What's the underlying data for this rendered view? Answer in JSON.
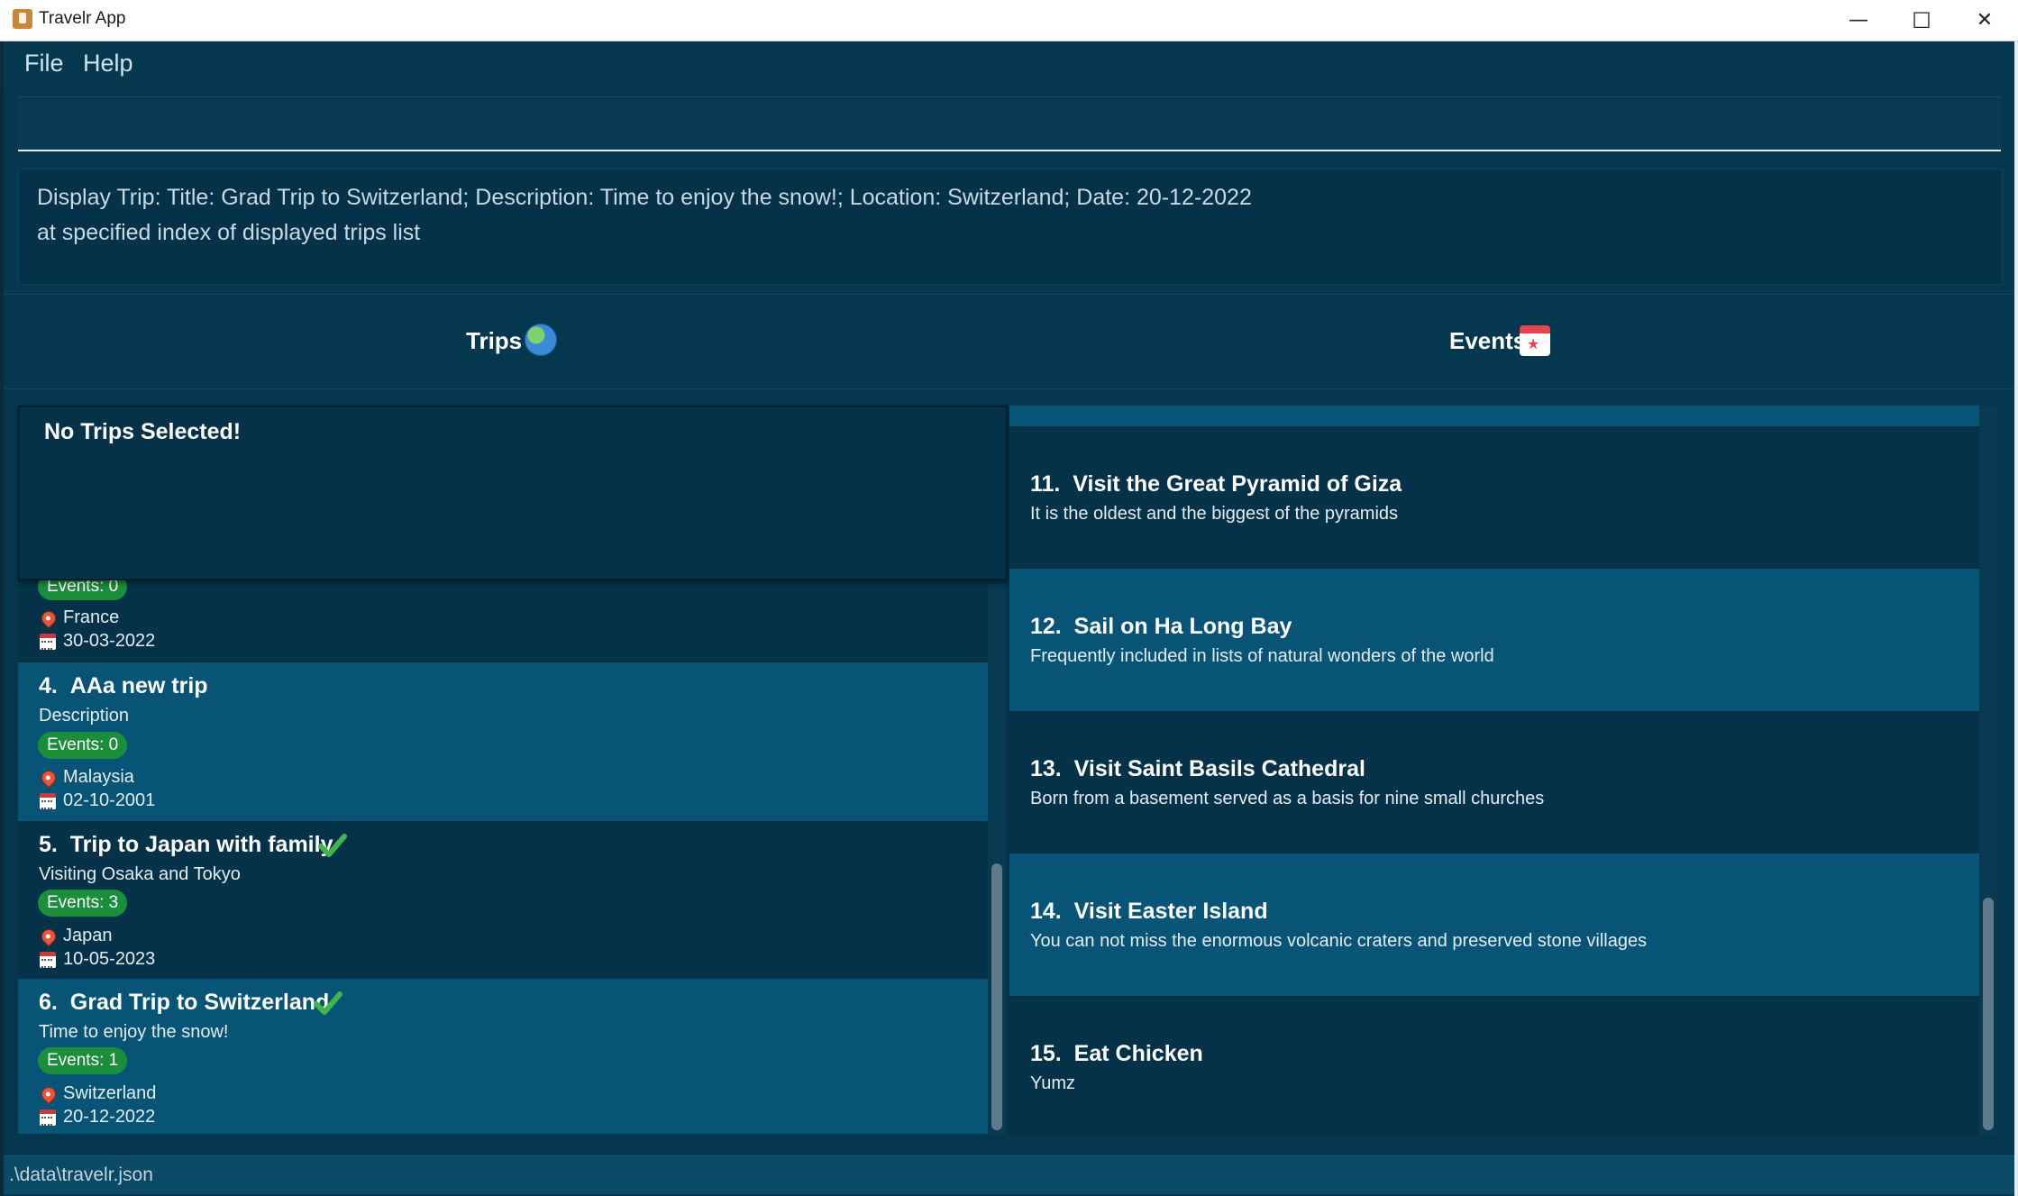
{
  "window": {
    "title": "Travelr App",
    "minimize_glyph": "—",
    "maximize_glyph": "☐",
    "close_glyph": "✕"
  },
  "menu": {
    "file": "File",
    "help": "Help"
  },
  "command_box": {
    "value": ""
  },
  "result_display": {
    "lines": [
      "Display Trip: Title: Grad Trip to Switzerland; Description: Time to enjoy the snow!; Location: Switzerland; Date: 20-12-2022",
      "at specified index of displayed trips list"
    ]
  },
  "tabs": {
    "trips": "Trips",
    "events": "Events"
  },
  "selected_trip": {
    "message": "No Trips Selected!"
  },
  "trips": [
    {
      "index": "",
      "title": "",
      "description": "",
      "events": "Events: 0",
      "location": "France",
      "date": "30-03-2022",
      "completed": false
    },
    {
      "index": "4.",
      "title": "AAa new trip",
      "description": "Description",
      "events": "Events: 0",
      "location": "Malaysia",
      "date": "02-10-2001",
      "completed": false
    },
    {
      "index": "5.",
      "title": "Trip to Japan with family",
      "description": "Visiting Osaka and Tokyo",
      "events": "Events: 3",
      "location": "Japan",
      "date": "10-05-2023",
      "completed": true
    },
    {
      "index": "6.",
      "title": "Grad Trip to Switzerland",
      "description": "Time to enjoy the snow!",
      "events": "Events: 1",
      "location": "Switzerland",
      "date": "20-12-2022",
      "completed": true
    }
  ],
  "events": [
    {
      "index": "11.",
      "title": "Visit the Great Pyramid of Giza",
      "description": "It is the oldest and the biggest of the pyramids"
    },
    {
      "index": "12.",
      "title": "Sail on Ha Long Bay",
      "description": "Frequently included in lists of natural wonders of the world"
    },
    {
      "index": "13.",
      "title": "Visit Saint Basils Cathedral",
      "description": "Born from a basement served as a basis for nine small churches"
    },
    {
      "index": "14.",
      "title": "Visit Easter Island",
      "description": "You can not miss the enormous volcanic craters and preserved stone villages"
    },
    {
      "index": "15.",
      "title": "Eat Chicken",
      "description": "Yumz"
    }
  ],
  "status_bar": {
    "file_path": ".\\data\\travelr.json"
  },
  "colors": {
    "background": "#05384f",
    "card_dark": "#053249",
    "card_light": "#075477",
    "events_pill": "#1b8e3c",
    "check": "#3fb54a"
  }
}
